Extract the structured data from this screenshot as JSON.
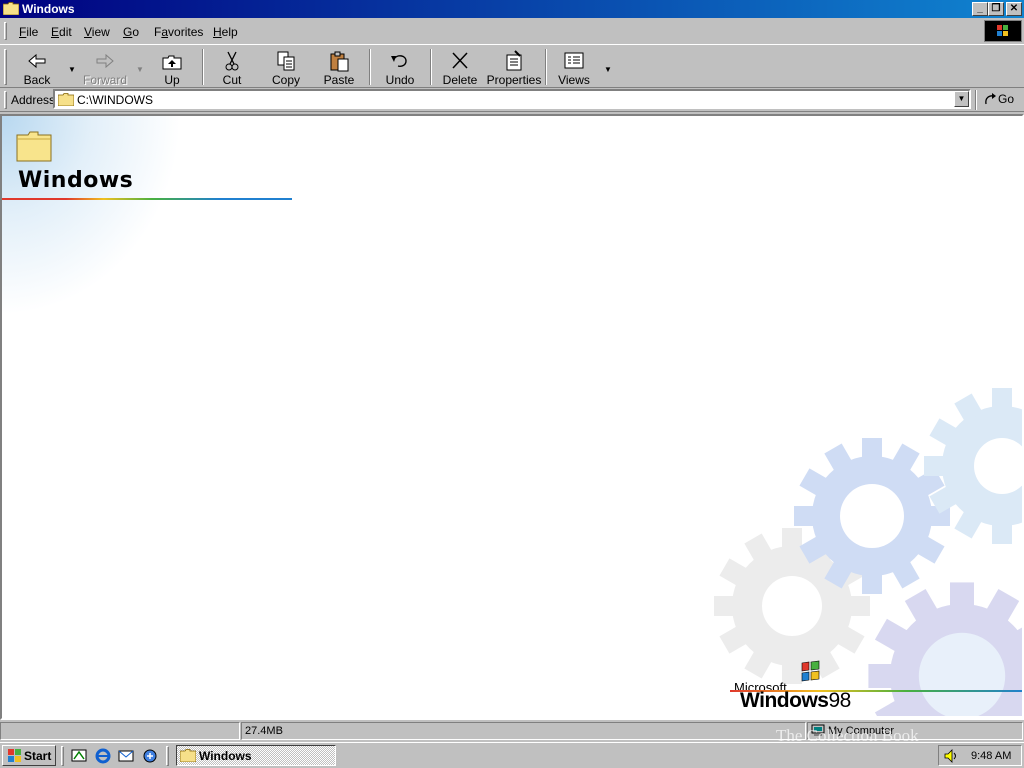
{
  "window": {
    "title": "Windows",
    "caption_buttons": [
      "minimize-icon",
      "restore-icon",
      "close-icon"
    ]
  },
  "menu": {
    "items": [
      {
        "label": "File",
        "accel": "F"
      },
      {
        "label": "Edit",
        "accel": "E"
      },
      {
        "label": "View",
        "accel": "V"
      },
      {
        "label": "Go",
        "accel": "G"
      },
      {
        "label": "Favorites",
        "accel": "a"
      },
      {
        "label": "Help",
        "accel": "H"
      }
    ]
  },
  "toolbar": {
    "back": "Back",
    "forward": "Forward",
    "up": "Up",
    "cut": "Cut",
    "copy": "Copy",
    "paste": "Paste",
    "undo": "Undo",
    "delete": "Delete",
    "properties": "Properties",
    "views": "Views"
  },
  "address": {
    "label": "Address",
    "value": "C:\\WINDOWS",
    "go": "Go"
  },
  "content": {
    "folder_title": "Windows",
    "logo_microsoft": "Microsoft",
    "logo_windows": "Windows",
    "logo_version": "98"
  },
  "status": {
    "pane1": "",
    "size": "27.4MB",
    "zone": "My Computer"
  },
  "taskbar": {
    "start": "Start",
    "task": "Windows",
    "clock": "9:48 AM"
  },
  "watermark": "The Collection Book",
  "colors": {
    "titlebar_start": "#000080",
    "titlebar_end": "#1084d0",
    "face": "#c0c0c0"
  }
}
